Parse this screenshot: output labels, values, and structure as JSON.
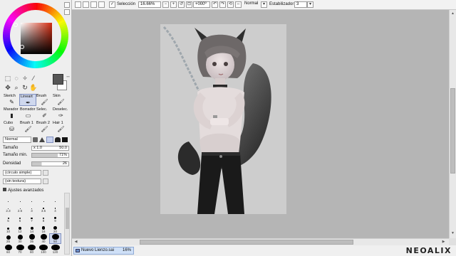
{
  "toolbar": {
    "selection_label": "Selección",
    "selection_checked": true,
    "zoom": "16.66%",
    "rotation": "+000º",
    "blend_mode": "Normal",
    "stabilizer_label": "Estabilizador",
    "stabilizer_value": "3"
  },
  "color": {
    "current": "#555555",
    "background": "#ffffff",
    "hue_square": "#d42b10"
  },
  "tools": [
    {
      "label": "Sketch",
      "icon": "pencil-icon"
    },
    {
      "label": "Lineart",
      "icon": "pen-icon",
      "selected": true
    },
    {
      "label": "Brush",
      "icon": "brush-icon"
    },
    {
      "label": "Skin",
      "icon": "brush-icon"
    },
    {
      "label": "Marador",
      "icon": "marker-icon"
    },
    {
      "label": "Borrador",
      "icon": "eraser-icon"
    },
    {
      "label": "Selec.",
      "icon": "select-pen-icon"
    },
    {
      "label": "Deselec.",
      "icon": "deselect-pen-icon"
    },
    {
      "label": "Cubo",
      "icon": "bucket-icon"
    },
    {
      "label": "Brush 1",
      "icon": "brush-icon"
    },
    {
      "label": "Brush 2",
      "icon": "brush-icon"
    },
    {
      "label": "Hair 1",
      "icon": "brush-icon"
    }
  ],
  "brush": {
    "mode": "Normal",
    "size_label": "Tamaño",
    "size_multiplier": "x 1.0",
    "size_value": "50.0",
    "min_size_label": "Tamaño min.",
    "min_size_value": "71%",
    "density_label": "Densidad",
    "density_value": "26",
    "shape": "(círculo simple)",
    "texture": "(sin textura)",
    "advanced_label": "Ajustes avanzados"
  },
  "brush_sizes": [
    {
      "label": "",
      "d": 1
    },
    {
      "label": "",
      "d": 1
    },
    {
      "label": "",
      "d": 1
    },
    {
      "label": "",
      "d": 1
    },
    {
      "label": "",
      "d": 1
    },
    {
      "label": "2.3",
      "d": 1
    },
    {
      "label": "2.6",
      "d": 1
    },
    {
      "label": "3",
      "d": 1
    },
    {
      "label": "3.5",
      "d": 1.5
    },
    {
      "label": "4",
      "d": 1.5
    },
    {
      "label": "5",
      "d": 2
    },
    {
      "label": "6",
      "d": 2
    },
    {
      "label": "7",
      "d": 2.5
    },
    {
      "label": "8",
      "d": 2.5
    },
    {
      "label": "9",
      "d": 3
    },
    {
      "label": "10",
      "d": 3
    },
    {
      "label": "12",
      "d": 3.5
    },
    {
      "label": "14",
      "d": 4
    },
    {
      "label": "16",
      "d": 4.5
    },
    {
      "label": "20",
      "d": 5
    },
    {
      "label": "25",
      "d": 6
    },
    {
      "label": "30",
      "d": 7
    },
    {
      "label": "35",
      "d": 8
    },
    {
      "label": "40",
      "d": 9
    },
    {
      "label": "50",
      "d": 10,
      "selected": true
    },
    {
      "label": "60",
      "d": 10
    },
    {
      "label": "70",
      "d": 11
    },
    {
      "label": "80",
      "d": 11
    },
    {
      "label": "100",
      "d": 12
    },
    {
      "label": "120",
      "d": 12
    }
  ],
  "status": {
    "document_name": "Nuevo Lienzo.sai",
    "document_zoom": "16%",
    "watermark": "NEOALIX"
  }
}
